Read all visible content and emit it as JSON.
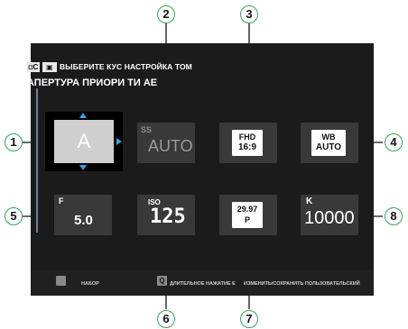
{
  "header": {
    "icon1": "◘C",
    "icon2": "▣",
    "line1": "ВЫБЕРИТЕ КУС НАСТРОЙКА ТОМ",
    "line2": "АПЕРТУРА ПРИОРИ ТИ АЕ"
  },
  "tiles": {
    "mode": {
      "value": "A"
    },
    "shutter": {
      "label": "SS",
      "value": "AUTO"
    },
    "movie": {
      "top": "FHD",
      "bottom": "16:9"
    },
    "wb": {
      "top": "WB",
      "bottom": "AUTO"
    },
    "aperture": {
      "label": "F",
      "value": "5.0"
    },
    "iso": {
      "label": "ISO",
      "value": "125"
    },
    "framerate": {
      "top": "29.97",
      "bottom": "P"
    },
    "kelvin": {
      "label": "K",
      "value": "10000"
    }
  },
  "footer": {
    "set_label": "НАБОР",
    "q_icon": "Q",
    "hold_label": "ДЛИТЕЛЬНОЕ НАЖАТИЕ Е",
    "save_label": "ИЗМЕНИТЬ/СОХРАНИТЬ ПОЛЬЗОВАТЕЛЬСКИЙ"
  },
  "callouts": [
    "1",
    "2",
    "3",
    "4",
    "5",
    "6",
    "7",
    "8"
  ],
  "colors": {
    "accent": "#3ea0e0",
    "callout_ring": "#3aa35a",
    "screen_bg": "#1b1b1b",
    "tile_bg": "#393939"
  }
}
